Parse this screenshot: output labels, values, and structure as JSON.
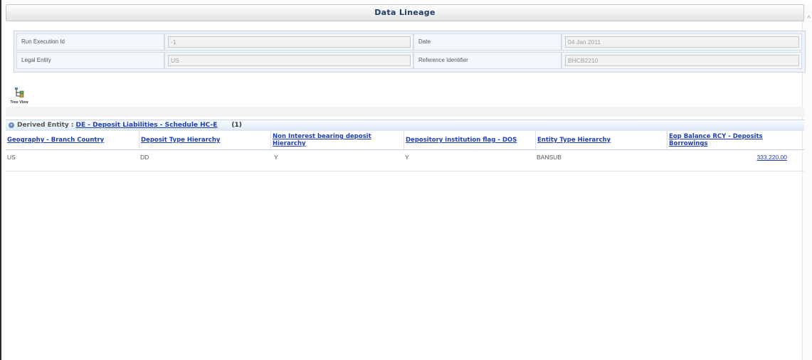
{
  "window": {
    "title": "Data Lineage"
  },
  "filters": {
    "run_execution_id": {
      "label": "Run Execution Id",
      "value": "-1"
    },
    "date": {
      "label": "Date",
      "value": "04 Jan 2011"
    },
    "legal_entity": {
      "label": "Legal Entity",
      "value": "US"
    },
    "reference_identifier": {
      "label": "Reference Identifier",
      "value": "BHCB2210"
    }
  },
  "toolbar": {
    "tree_view_label": "Tree View"
  },
  "derived_entity": {
    "prefix": "Derived Entity :",
    "name": "DE - Deposit Liabilities - Schedule HC-E",
    "count": "(1)"
  },
  "table": {
    "columns": [
      "Geography - Branch Country",
      "Deposit Type Hierarchy",
      "Non Interest bearing deposit Hierarchy",
      "Depository institution flag - DOS",
      "Entity Type Hierarchy",
      "Eop Balance RCY - Deposits Borrowings"
    ],
    "rows": [
      [
        "US",
        "DD",
        "Y",
        "Y",
        "BANSUB",
        "333,220.00"
      ]
    ]
  },
  "colors": {
    "link": "#1f3fb5",
    "title_text": "#1e3c64",
    "panel_background": "#eef3f9"
  }
}
